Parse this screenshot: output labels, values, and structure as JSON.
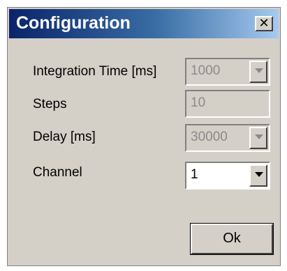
{
  "window": {
    "title": "Configuration",
    "close_glyph": "✕"
  },
  "fields": {
    "integration_time": {
      "label": "Integration Time [ms]",
      "value": "1000"
    },
    "steps": {
      "label": "Steps",
      "value": "10"
    },
    "delay": {
      "label": "Delay [ms]",
      "value": "30000"
    },
    "channel": {
      "label": "Channel",
      "value": "1"
    }
  },
  "buttons": {
    "ok": "Ok"
  },
  "icons": {
    "close": "close-icon",
    "dropdown": "chevron-down-icon"
  },
  "colors": {
    "title_start": "#0a246a",
    "title_end": "#a6caf0",
    "face": "#d4d0c8",
    "disabled_text": "#8a8a8a"
  }
}
